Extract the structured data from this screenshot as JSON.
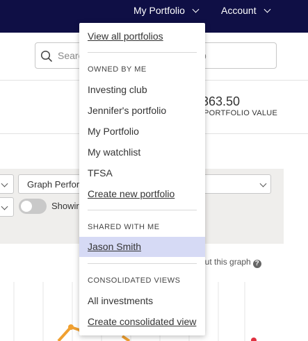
{
  "topnav": {
    "portfolio_label": "My Portfolio",
    "account_label": "Account",
    "background": "#0f0f45"
  },
  "search": {
    "placeholder_visible": "Searc",
    "trailing_visible": "p"
  },
  "summary": {
    "value_visible": ",363.50",
    "label_visible": "PORTFOLIO VALUE"
  },
  "controls": {
    "graph_select_visible": "Graph Perfor",
    "toggle_label_visible": "Showir",
    "about_graph_visible": "out this graph",
    "help_glyph": "?"
  },
  "dropdown": {
    "view_all": "View all portfolios",
    "owned_header": "OWNED BY ME",
    "owned_items": [
      "Investing club",
      "Jennifer's portfolio",
      "My Portfolio",
      "My watchlist",
      "TFSA"
    ],
    "create_portfolio": "Create new portfolio",
    "shared_header": "SHARED WITH ME",
    "shared_items": [
      "Jason Smith"
    ],
    "consolidated_header": "CONSOLIDATED VIEWS",
    "consolidated_items": [
      "All investments"
    ],
    "create_consolidated": "Create consolidated view",
    "selected_bg": "#d6daf5"
  },
  "colors": {
    "chart_line": "#f0a030",
    "chart_marker": "#e03040",
    "panel_bg": "#efeeec"
  }
}
